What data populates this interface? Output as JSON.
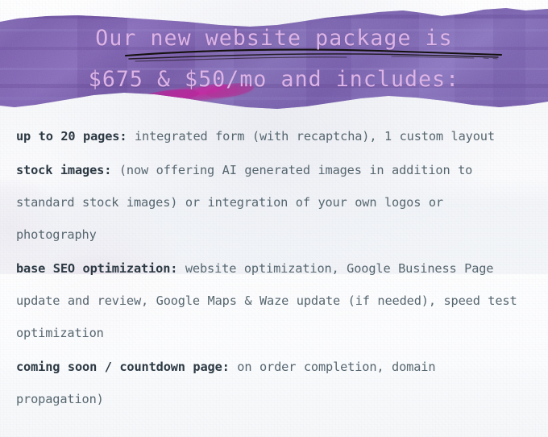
{
  "meta": {
    "background_color": "#fbfbfc",
    "banner_color_main": "#7b5fae",
    "banner_color_light": "#8d74bd",
    "banner_color_dark": "#6c4fa0",
    "banner_accent_magenta": "#b8309a",
    "title_text_color": "#ddb4e6",
    "body_heading_color": "#2c3943",
    "body_text_color": "#56666f"
  },
  "banner": {
    "title_line_1": "Our new website package is",
    "title_line_2": "$675 & $50/mo and includes:",
    "underline_icon": "hand-drawn-underline-icon",
    "accent_icon": "magenta-brush-stroke-icon"
  },
  "pricing": {
    "setup_fee": "$675",
    "monthly_fee": "$50/mo"
  },
  "features": [
    {
      "lead": "up to 20 pages:",
      "detail": " integrated form (with recaptcha), 1 custom layout"
    },
    {
      "lead": "stock images:",
      "detail": " (now offering AI generated images in addition to standard stock images) or integration of your own logos or photography"
    },
    {
      "lead": "base SEO optimization:",
      "detail": " website optimization, Google Business Page update and review, Google Maps & Waze update (if needed), speed test optimization"
    },
    {
      "lead": "coming soon / countdown page:",
      "detail": " on order completion, domain propagation)"
    }
  ]
}
